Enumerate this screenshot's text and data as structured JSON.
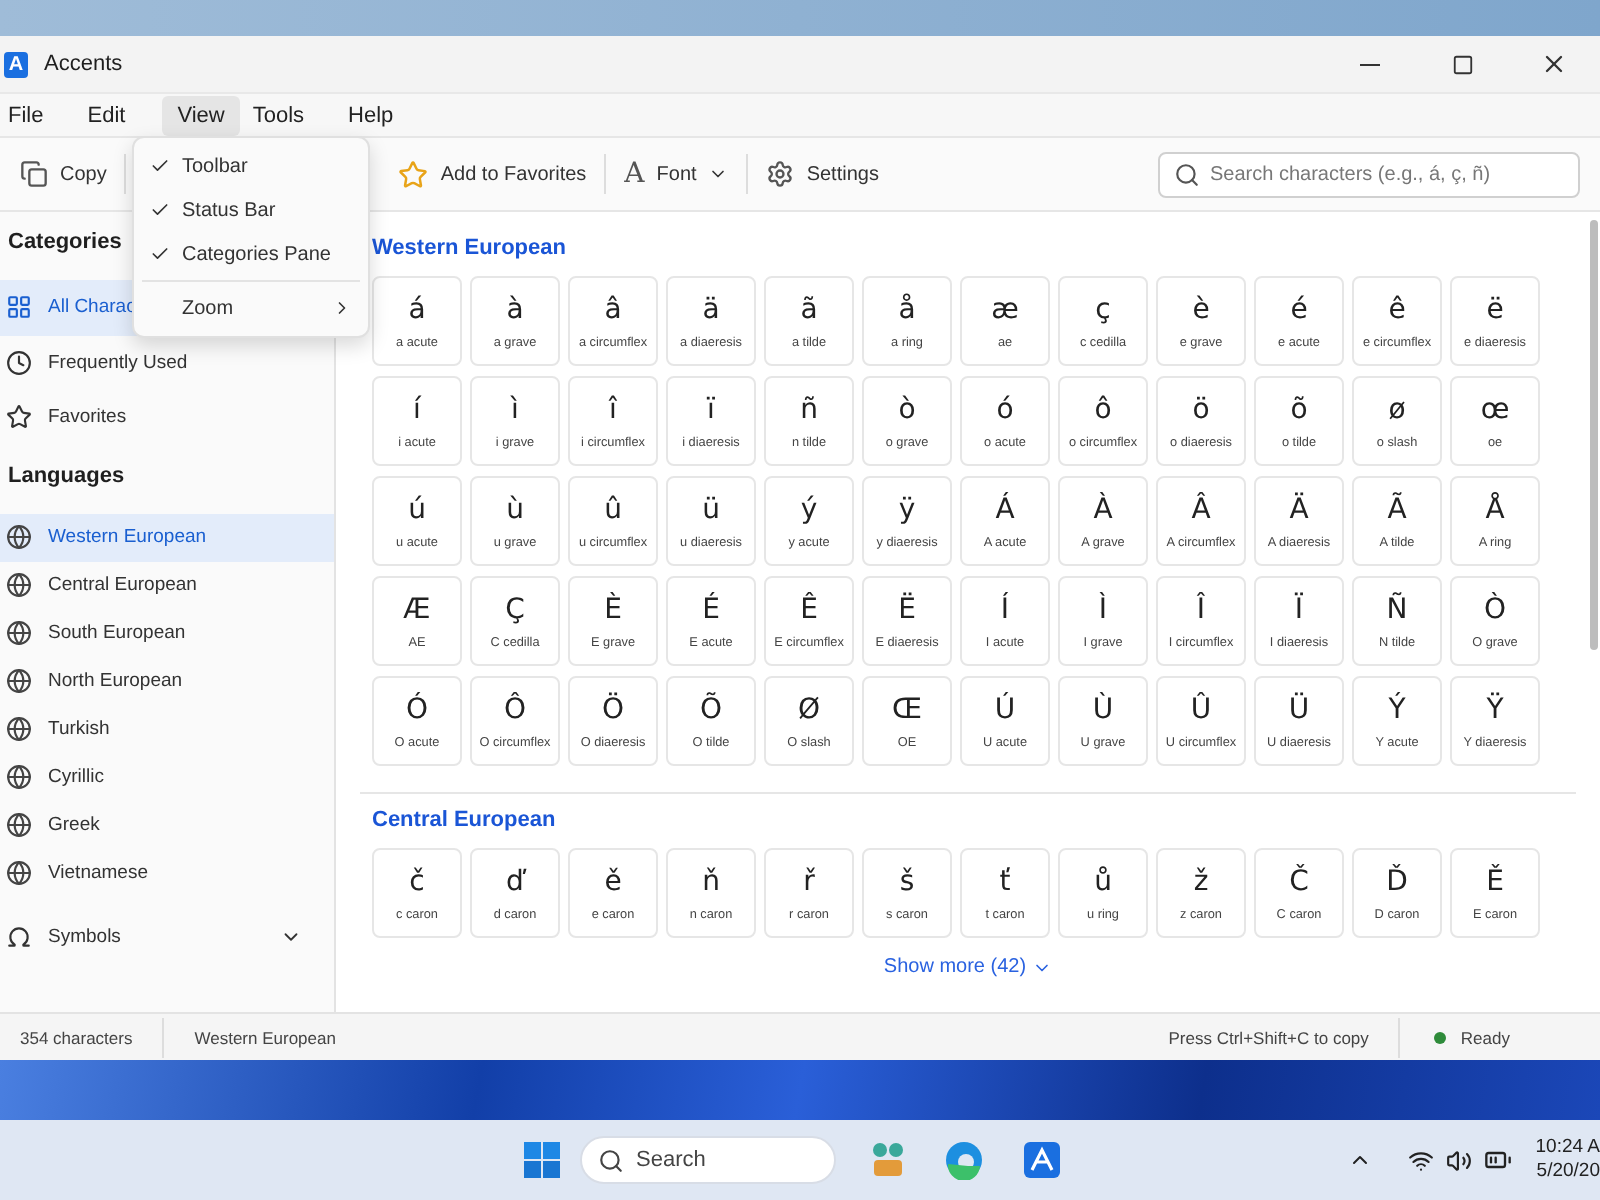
{
  "window": {
    "title": "Accents",
    "logo_letter": "A"
  },
  "menu_bar": [
    {
      "label": "File",
      "selected": false
    },
    {
      "label": "Edit",
      "selected": false
    },
    {
      "label": "View",
      "selected": true
    },
    {
      "label": "Tools",
      "selected": false
    },
    {
      "label": "Help",
      "selected": false
    }
  ],
  "view_menu": [
    {
      "kind": "check",
      "label": "Toolbar",
      "checked": true
    },
    {
      "kind": "check",
      "label": "Status Bar",
      "checked": true
    },
    {
      "kind": "check",
      "label": "Categories Pane",
      "checked": true
    },
    {
      "kind": "submenu",
      "label": "Zoom"
    }
  ],
  "toolbar": {
    "copy": "Copy",
    "favorites": "Add to Favorites",
    "font_glyph": "A",
    "font": "Font",
    "settings": "Settings",
    "search_placeholder": "Search characters (e.g., á, ç, ñ)"
  },
  "sidebar": {
    "categories_heading": "Categories",
    "categories": [
      {
        "label": "All Charac",
        "selected": true
      },
      {
        "label": "Frequently Used",
        "selected": false
      },
      {
        "label": "Favorites",
        "selected": false
      }
    ],
    "languages_heading": "Languages",
    "languages": [
      {
        "label": "Western European",
        "selected": true
      },
      {
        "label": "Central European",
        "selected": false
      },
      {
        "label": "South European",
        "selected": false
      },
      {
        "label": "North European",
        "selected": false
      },
      {
        "label": "Turkish",
        "selected": false
      },
      {
        "label": "Cyrillic",
        "selected": false
      },
      {
        "label": "Greek",
        "selected": false
      },
      {
        "label": "Vietnamese",
        "selected": false
      }
    ],
    "symbols": {
      "label": "Symbols",
      "expanded": false
    }
  },
  "sections": [
    {
      "title": "Western European",
      "characters": [
        {
          "char": "á",
          "name": "a acute"
        },
        {
          "char": "à",
          "name": "a grave"
        },
        {
          "char": "â",
          "name": "a circumflex"
        },
        {
          "char": "ä",
          "name": "a diaeresis"
        },
        {
          "char": "ã",
          "name": "a tilde"
        },
        {
          "char": "å",
          "name": "a ring"
        },
        {
          "char": "æ",
          "name": "ae"
        },
        {
          "char": "ç",
          "name": "c cedilla"
        },
        {
          "char": "è",
          "name": "e grave"
        },
        {
          "char": "é",
          "name": "e acute"
        },
        {
          "char": "ê",
          "name": "e circumflex"
        },
        {
          "char": "ë",
          "name": "e diaeresis"
        },
        {
          "char": "í",
          "name": "i acute"
        },
        {
          "char": "ì",
          "name": "i grave"
        },
        {
          "char": "î",
          "name": "i circumflex"
        },
        {
          "char": "ï",
          "name": "i diaeresis"
        },
        {
          "char": "ñ",
          "name": "n tilde"
        },
        {
          "char": "ò",
          "name": "o grave"
        },
        {
          "char": "ó",
          "name": "o acute"
        },
        {
          "char": "ô",
          "name": "o circumflex"
        },
        {
          "char": "ö",
          "name": "o diaeresis"
        },
        {
          "char": "õ",
          "name": "o tilde"
        },
        {
          "char": "ø",
          "name": "o slash"
        },
        {
          "char": "œ",
          "name": "oe"
        },
        {
          "char": "ú",
          "name": "u acute"
        },
        {
          "char": "ù",
          "name": "u grave"
        },
        {
          "char": "û",
          "name": "u circumflex"
        },
        {
          "char": "ü",
          "name": "u diaeresis"
        },
        {
          "char": "ý",
          "name": "y acute"
        },
        {
          "char": "ÿ",
          "name": "y diaeresis"
        },
        {
          "char": "Á",
          "name": "A acute"
        },
        {
          "char": "À",
          "name": "A grave"
        },
        {
          "char": "Â",
          "name": "A circumflex"
        },
        {
          "char": "Ä",
          "name": "A diaeresis"
        },
        {
          "char": "Ã",
          "name": "A tilde"
        },
        {
          "char": "Å",
          "name": "A ring"
        },
        {
          "char": "Æ",
          "name": "AE"
        },
        {
          "char": "Ç",
          "name": "C cedilla"
        },
        {
          "char": "È",
          "name": "E grave"
        },
        {
          "char": "É",
          "name": "E acute"
        },
        {
          "char": "Ê",
          "name": "E circumflex"
        },
        {
          "char": "Ë",
          "name": "E diaeresis"
        },
        {
          "char": "Í",
          "name": "I acute"
        },
        {
          "char": "Ì",
          "name": "I grave"
        },
        {
          "char": "Î",
          "name": "I circumflex"
        },
        {
          "char": "Ï",
          "name": "I diaeresis"
        },
        {
          "char": "Ñ",
          "name": "N tilde"
        },
        {
          "char": "Ò",
          "name": "O grave"
        },
        {
          "char": "Ó",
          "name": "O acute"
        },
        {
          "char": "Ô",
          "name": "O circumflex"
        },
        {
          "char": "Ö",
          "name": "O diaeresis"
        },
        {
          "char": "Õ",
          "name": "O tilde"
        },
        {
          "char": "Ø",
          "name": "O slash"
        },
        {
          "char": "Œ",
          "name": "OE"
        },
        {
          "char": "Ú",
          "name": "U acute"
        },
        {
          "char": "Ù",
          "name": "U grave"
        },
        {
          "char": "Û",
          "name": "U circumflex"
        },
        {
          "char": "Ü",
          "name": "U diaeresis"
        },
        {
          "char": "Ý",
          "name": "Y acute"
        },
        {
          "char": "Ÿ",
          "name": "Y diaeresis"
        }
      ]
    },
    {
      "title": "Central European",
      "characters": [
        {
          "char": "č",
          "name": "c caron"
        },
        {
          "char": "ď",
          "name": "d caron"
        },
        {
          "char": "ě",
          "name": "e caron"
        },
        {
          "char": "ň",
          "name": "n caron"
        },
        {
          "char": "ř",
          "name": "r caron"
        },
        {
          "char": "š",
          "name": "s caron"
        },
        {
          "char": "ť",
          "name": "t caron"
        },
        {
          "char": "ů",
          "name": "u ring"
        },
        {
          "char": "ž",
          "name": "z caron"
        },
        {
          "char": "Č",
          "name": "C caron"
        },
        {
          "char": "Ď",
          "name": "D caron"
        },
        {
          "char": "Ě",
          "name": "E caron"
        }
      ],
      "show_more": "Show more (42)"
    }
  ],
  "status_bar": {
    "count": "354 characters",
    "category": "Western European",
    "hint": "Press Ctrl+Shift+C to copy",
    "state": "Ready"
  },
  "taskbar": {
    "search": "Search",
    "time": "10:24 A",
    "date": "5/20/20"
  }
}
